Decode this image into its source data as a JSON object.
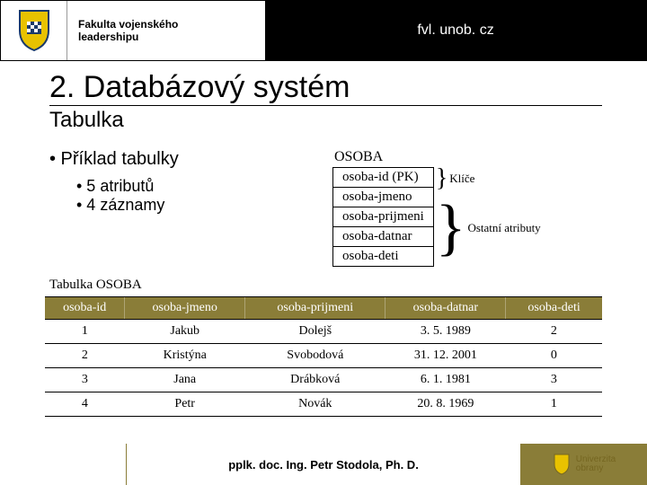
{
  "header": {
    "faculty_line1": "Fakulta vojenského",
    "faculty_line2": "leadershipu",
    "url": "fvl. unob. cz"
  },
  "h1": "2. Databázový systém",
  "h2": "Tabulka",
  "bullet1": "• Příklad tabulky",
  "bullet2a": "• 5 atributů",
  "bullet2b": "• 4 záznamy",
  "schema": {
    "title": "OSOBA",
    "pk": "osoba-id (PK)",
    "attrs": [
      "osoba-jmeno",
      "osoba-prijmeni",
      "osoba-datnar",
      "osoba-deti"
    ],
    "key_label": "Klíče",
    "rest_label": "Ostatní atributy"
  },
  "table_label": "Tabulka OSOBA",
  "columns": [
    "osoba-id",
    "osoba-jmeno",
    "osoba-prijmeni",
    "osoba-datnar",
    "osoba-deti"
  ],
  "rows": [
    [
      "1",
      "Jakub",
      "Dolejš",
      "3. 5. 1989",
      "2"
    ],
    [
      "2",
      "Kristýna",
      "Svobodová",
      "31. 12. 2001",
      "0"
    ],
    [
      "3",
      "Jana",
      "Drábková",
      "6. 1. 1981",
      "3"
    ],
    [
      "4",
      "Petr",
      "Novák",
      "20. 8. 1969",
      "1"
    ]
  ],
  "footer": {
    "author": "pplk. doc. Ing. Petr Stodola, Ph. D.",
    "uni_line1": "Univerzita",
    "uni_line2": "obrany"
  },
  "chart_data": {
    "type": "table",
    "title": "Tabulka OSOBA",
    "columns": [
      "osoba-id",
      "osoba-jmeno",
      "osoba-prijmeni",
      "osoba-datnar",
      "osoba-deti"
    ],
    "rows": [
      [
        1,
        "Jakub",
        "Dolejš",
        "3. 5. 1989",
        2
      ],
      [
        2,
        "Kristýna",
        "Svobodová",
        "31. 12. 2001",
        0
      ],
      [
        3,
        "Jana",
        "Drábková",
        "6. 1. 1981",
        3
      ],
      [
        4,
        "Petr",
        "Novák",
        "20. 8. 1969",
        1
      ]
    ]
  }
}
